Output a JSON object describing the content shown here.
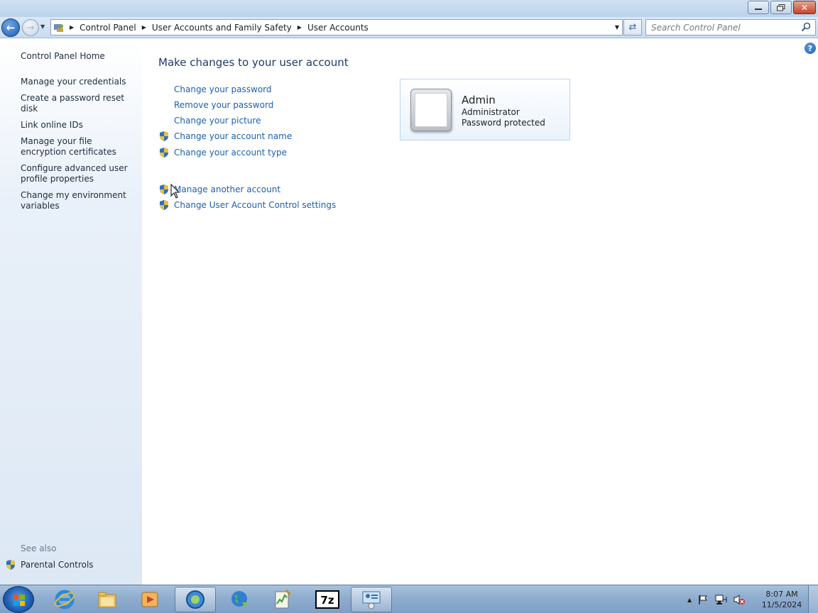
{
  "window": {
    "minimize_icon": "minimize-icon",
    "restore_icon": "restore-icon",
    "close_label": "✕"
  },
  "navigation": {
    "breadcrumbs": [
      "Control Panel",
      "User Accounts and Family Safety",
      "User Accounts"
    ],
    "search_placeholder": "Search Control Panel"
  },
  "sidebar": {
    "home": "Control Panel Home",
    "items": [
      {
        "label": "Manage your credentials"
      },
      {
        "label": "Create a password reset disk"
      },
      {
        "label": "Link online IDs"
      },
      {
        "label": "Manage your file encryption certificates"
      },
      {
        "label": "Configure advanced user profile properties"
      },
      {
        "label": "Change my environment variables"
      }
    ],
    "see_also": "See also",
    "parental_controls": "Parental Controls"
  },
  "main": {
    "title": "Make changes to your user account",
    "tasks": [
      {
        "label": "Change your password",
        "shield": false
      },
      {
        "label": "Remove your password",
        "shield": false
      },
      {
        "label": "Change your picture",
        "shield": false
      },
      {
        "label": "Change your account name",
        "shield": true
      },
      {
        "label": "Change your account type",
        "shield": true
      }
    ],
    "other_tasks": [
      {
        "label": "Manage another account",
        "shield": true
      },
      {
        "label": "Change User Account Control settings",
        "shield": true
      }
    ]
  },
  "user": {
    "name": "Admin",
    "role": "Administrator",
    "status": "Password protected"
  },
  "taskbar": {
    "time": "8:07 AM",
    "date": "11/5/2024",
    "apps": [
      "internet-explorer",
      "windows-explorer",
      "media-player",
      "network-app",
      "globe-app",
      "notepad-app",
      "7zip-app",
      "control-panel-app"
    ]
  },
  "colors": {
    "link": "#1c5fb0",
    "title": "#1e3a6b",
    "sidebar_bg": "#dde8f5"
  }
}
